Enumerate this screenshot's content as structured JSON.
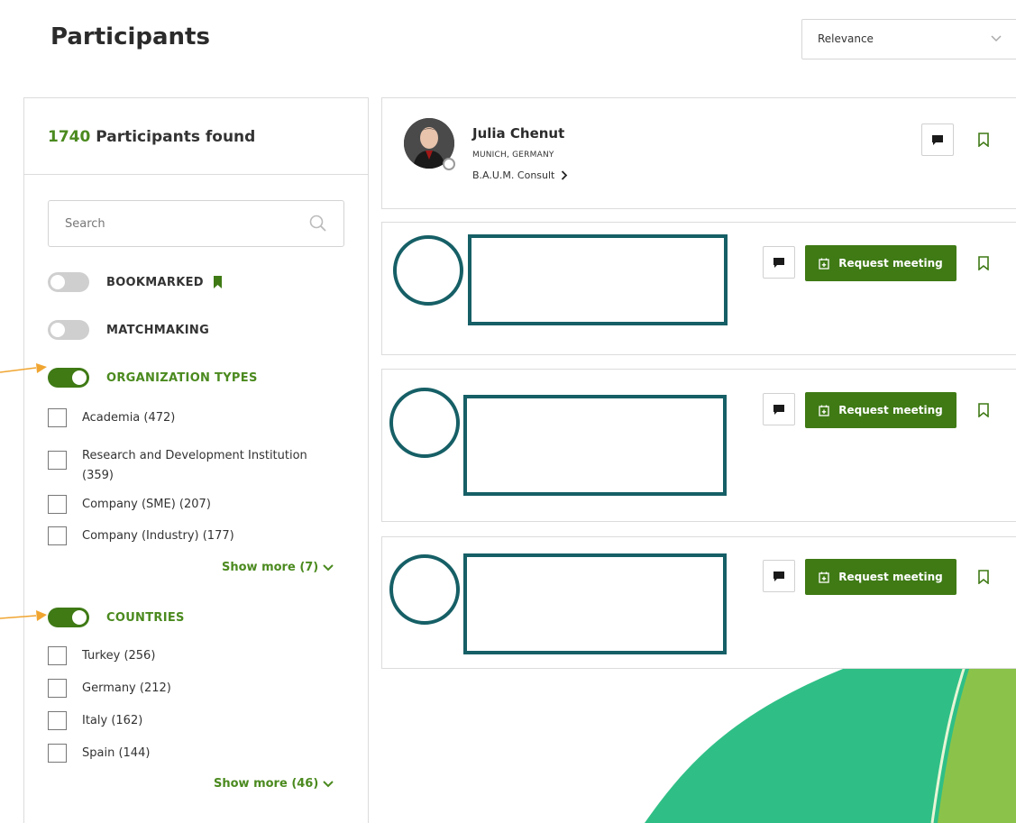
{
  "page": {
    "title": "Participants"
  },
  "sort": {
    "value": "Relevance"
  },
  "sidebar": {
    "found_count": "1740",
    "found_label": "Participants found",
    "search_placeholder": "Search",
    "toggles": {
      "bookmarked": {
        "label": "BOOKMARKED",
        "on": false
      },
      "matchmaking": {
        "label": "MATCHMAKING",
        "on": false
      },
      "organization_types": {
        "label": "ORGANIZATION TYPES",
        "on": true
      },
      "countries": {
        "label": "COUNTRIES",
        "on": true
      }
    },
    "organization_types": [
      {
        "label": "Academia (472)"
      },
      {
        "label": "Research and Development Institution (359)"
      },
      {
        "label": "Company (SME) (207)"
      },
      {
        "label": "Company (Industry) (177)"
      }
    ],
    "org_show_more": "Show more (7)",
    "countries": [
      {
        "label": "Turkey (256)"
      },
      {
        "label": "Germany (212)"
      },
      {
        "label": "Italy (162)"
      },
      {
        "label": "Spain (144)"
      }
    ],
    "countries_show_more": "Show more (46)"
  },
  "participants": [
    {
      "name": "Julia Chenut",
      "location": "MUNICH, GERMANY",
      "organization": "B.A.U.M. Consult"
    }
  ],
  "card_actions": {
    "request_meeting": "Request meeting"
  },
  "colors": {
    "accent": "#3f7a15",
    "accent_text": "#4b8a1f",
    "redaction": "#165f66",
    "arrow": "#f0a531"
  }
}
